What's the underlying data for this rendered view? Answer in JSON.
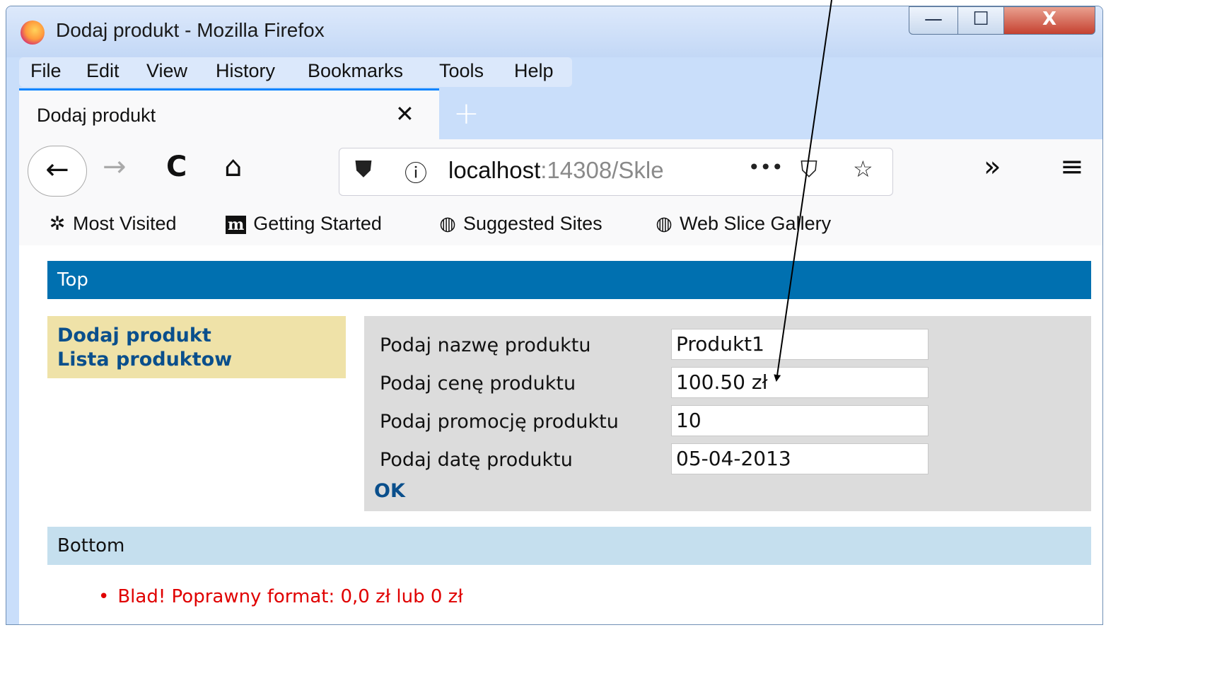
{
  "window": {
    "title": "Dodaj produkt - Mozilla Firefox",
    "controls": {
      "minimize": "—",
      "maximize": "☐",
      "close": "X"
    }
  },
  "menu": [
    "File",
    "Edit",
    "View",
    "History",
    "Bookmarks",
    "Tools",
    "Help"
  ],
  "tab": {
    "title": "Dodaj produkt",
    "close": "✕",
    "new_tab": "+"
  },
  "nav": {
    "back": "←",
    "forward": "→",
    "reload": "C",
    "home": "⌂",
    "url_host": "localhost",
    "url_rest": ":14308/Skle",
    "page_actions": "•••",
    "pocket": "⛉",
    "star": "☆",
    "overflow": "»",
    "menu": "≡",
    "shield": "⛊",
    "info": "ⓘ"
  },
  "bookmarks": [
    "Most Visited",
    "Getting Started",
    "Suggested Sites",
    "Web Slice Gallery"
  ],
  "bookmark_m": "m",
  "page": {
    "top": "Top",
    "sidebar": [
      "Dodaj produkt",
      "Lista produktow"
    ],
    "form": {
      "fields": [
        {
          "label": "Podaj nazwę produktu",
          "value": "Produkt1"
        },
        {
          "label": "Podaj cenę produktu",
          "value": "100.50 zł"
        },
        {
          "label": "Podaj promocję produktu",
          "value": "10"
        },
        {
          "label": "Podaj datę produktu",
          "value": "05-04-2013"
        }
      ],
      "submit": "OK"
    },
    "bottom": "Bottom",
    "error": "Blad! Poprawny format: 0,0 zł lub 0 zł"
  }
}
